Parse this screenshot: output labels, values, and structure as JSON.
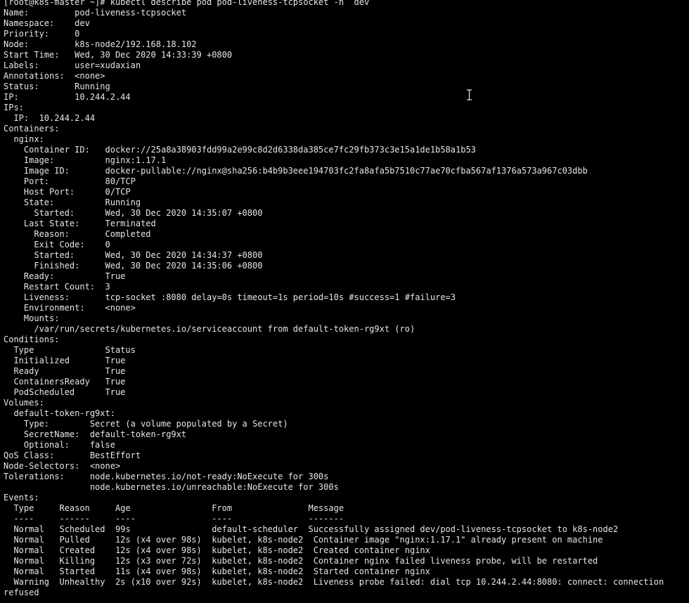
{
  "terminal": {
    "lines": [
      "[root@k8s-master ~]# kubectl describe pod pod-liveness-tcpsocket -n  dev",
      "Name:         pod-liveness-tcpsocket",
      "Namespace:    dev",
      "Priority:     0",
      "Node:         k8s-node2/192.168.18.102",
      "Start Time:   Wed, 30 Dec 2020 14:33:39 +0800",
      "Labels:       user=xudaxian",
      "Annotations:  <none>",
      "Status:       Running",
      "IP:           10.244.2.44",
      "IPs:",
      "  IP:  10.244.2.44",
      "Containers:",
      "  nginx:",
      "    Container ID:   docker://25a8a38903fdd99a2e99c8d2d6338da385ce7fc29fb373c3e15a1de1b58a1b53",
      "    Image:          nginx:1.17.1",
      "    Image ID:       docker-pullable://nginx@sha256:b4b9b3eee194703fc2fa8afa5b7510c77ae70cfba567af1376a573a967c03dbb",
      "    Port:           80/TCP",
      "    Host Port:      0/TCP",
      "    State:          Running",
      "      Started:      Wed, 30 Dec 2020 14:35:07 +0800",
      "    Last State:     Terminated",
      "      Reason:       Completed",
      "      Exit Code:    0",
      "      Started:      Wed, 30 Dec 2020 14:34:37 +0800",
      "      Finished:     Wed, 30 Dec 2020 14:35:06 +0800",
      "    Ready:          True",
      "    Restart Count:  3",
      "    Liveness:       tcp-socket :8080 delay=0s timeout=1s period=10s #success=1 #failure=3",
      "    Environment:    <none>",
      "    Mounts:",
      "      /var/run/secrets/kubernetes.io/serviceaccount from default-token-rg9xt (ro)",
      "Conditions:",
      "  Type              Status",
      "  Initialized       True",
      "  Ready             True",
      "  ContainersReady   True",
      "  PodScheduled      True",
      "Volumes:",
      "  default-token-rg9xt:",
      "    Type:        Secret (a volume populated by a Secret)",
      "    SecretName:  default-token-rg9xt",
      "    Optional:    false",
      "QoS Class:       BestEffort",
      "Node-Selectors:  <none>",
      "Tolerations:     node.kubernetes.io/not-ready:NoExecute for 300s",
      "                 node.kubernetes.io/unreachable:NoExecute for 300s",
      "Events:",
      "  Type     Reason     Age                From               Message",
      "  ----     ------     ----               ----               -------",
      "  Normal   Scheduled  99s                default-scheduler  Successfully assigned dev/pod-liveness-tcpsocket to k8s-node2",
      "  Normal   Pulled     12s (x4 over 98s)  kubelet, k8s-node2  Container image \"nginx:1.17.1\" already present on machine",
      "  Normal   Created    12s (x4 over 98s)  kubelet, k8s-node2  Created container nginx",
      "  Normal   Killing    12s (x3 over 72s)  kubelet, k8s-node2  Container nginx failed liveness probe, will be restarted",
      "  Normal   Started    11s (x4 over 98s)  kubelet, k8s-node2  Started container nginx",
      "  Warning  Unhealthy  2s (x10 over 92s)  kubelet, k8s-node2  Liveness probe failed: dial tcp 10.244.2.44:8080: connect: connection",
      "refused"
    ],
    "highlight": {
      "line_index": 56,
      "text": "dial tcp 10.244.2.44:8080: connect: connection",
      "color": "#d31d1d"
    },
    "colors": {
      "background": "#000000",
      "text": "#e6e6e6"
    },
    "cursor_icon": "i-beam-cursor-icon"
  }
}
